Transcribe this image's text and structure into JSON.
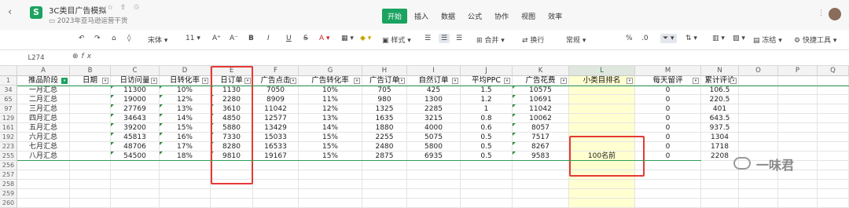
{
  "titlebar": {
    "doc_title": "3C类目广告模拟",
    "doc_path": "2023年亚马逊运营干货",
    "menu": [
      "开始",
      "插入",
      "数据",
      "公式",
      "协作",
      "视图",
      "效率"
    ],
    "active_menu": "开始"
  },
  "toolbar": {
    "font_name": "宋体",
    "font_size": "11",
    "style_label": "样式",
    "merge_label": "合并",
    "wrap_label": "换行",
    "format_label": "常规",
    "freeze_label": "冻结",
    "quick_tools_label": "快捷工具"
  },
  "formula_bar": {
    "cell_ref": "L274",
    "fx_label": "fx"
  },
  "sheet": {
    "columns": [
      "A",
      "B",
      "C",
      "D",
      "E",
      "F",
      "G",
      "H",
      "I",
      "J",
      "K",
      "L",
      "M",
      "N",
      "O",
      "P",
      "Q"
    ],
    "header_row_number": "1",
    "headers": [
      "推品阶段",
      "日期",
      "日访问量",
      "日转化率",
      "日订单",
      "广告点击",
      "广告转化率",
      "广告订单",
      "自然订单",
      "平均PPC",
      "广告花费",
      "小类目排名",
      "每天留评",
      "累计评论"
    ],
    "rows": [
      {
        "num": "34",
        "cells": [
          "一月汇总",
          "",
          "11300",
          "10%",
          "1130",
          "7050",
          "10%",
          "705",
          "425",
          "1.5",
          "10575",
          "",
          "0",
          "106.5"
        ]
      },
      {
        "num": "65",
        "cells": [
          "二月汇总",
          "",
          "19000",
          "12%",
          "2280",
          "8909",
          "11%",
          "980",
          "1300",
          "1.2",
          "10691",
          "",
          "0",
          "220.5"
        ]
      },
      {
        "num": "97",
        "cells": [
          "三月汇总",
          "",
          "27769",
          "13%",
          "3610",
          "11042",
          "12%",
          "1325",
          "2285",
          "1",
          "11042",
          "",
          "0",
          "401"
        ]
      },
      {
        "num": "129",
        "cells": [
          "四月汇总",
          "",
          "34643",
          "14%",
          "4850",
          "12577",
          "13%",
          "1635",
          "3215",
          "0.8",
          "10062",
          "",
          "0",
          "643.5"
        ]
      },
      {
        "num": "161",
        "cells": [
          "五月汇总",
          "",
          "39200",
          "15%",
          "5880",
          "13429",
          "14%",
          "1880",
          "4000",
          "0.6",
          "8057",
          "",
          "0",
          "937.5"
        ]
      },
      {
        "num": "192",
        "cells": [
          "六月汇总",
          "",
          "45813",
          "16%",
          "7330",
          "15033",
          "15%",
          "2255",
          "5075",
          "0.5",
          "7517",
          "",
          "0",
          "1304"
        ]
      },
      {
        "num": "223",
        "cells": [
          "七月汇总",
          "",
          "48706",
          "17%",
          "8280",
          "16533",
          "15%",
          "2480",
          "5800",
          "0.5",
          "8267",
          "",
          "0",
          "1718"
        ]
      },
      {
        "num": "255",
        "cells": [
          "八月汇总",
          "",
          "54500",
          "18%",
          "9810",
          "19167",
          "15%",
          "2875",
          "6935",
          "0.5",
          "9583",
          "100名前",
          "0",
          "2208"
        ]
      }
    ],
    "empty_rows": [
      "256",
      "257",
      "258",
      "259",
      "260"
    ]
  },
  "watermark": "一味君",
  "colors": {
    "accent": "#1aa260",
    "highlight_column": "#ffffd0",
    "annotation_box": "#e53935"
  }
}
